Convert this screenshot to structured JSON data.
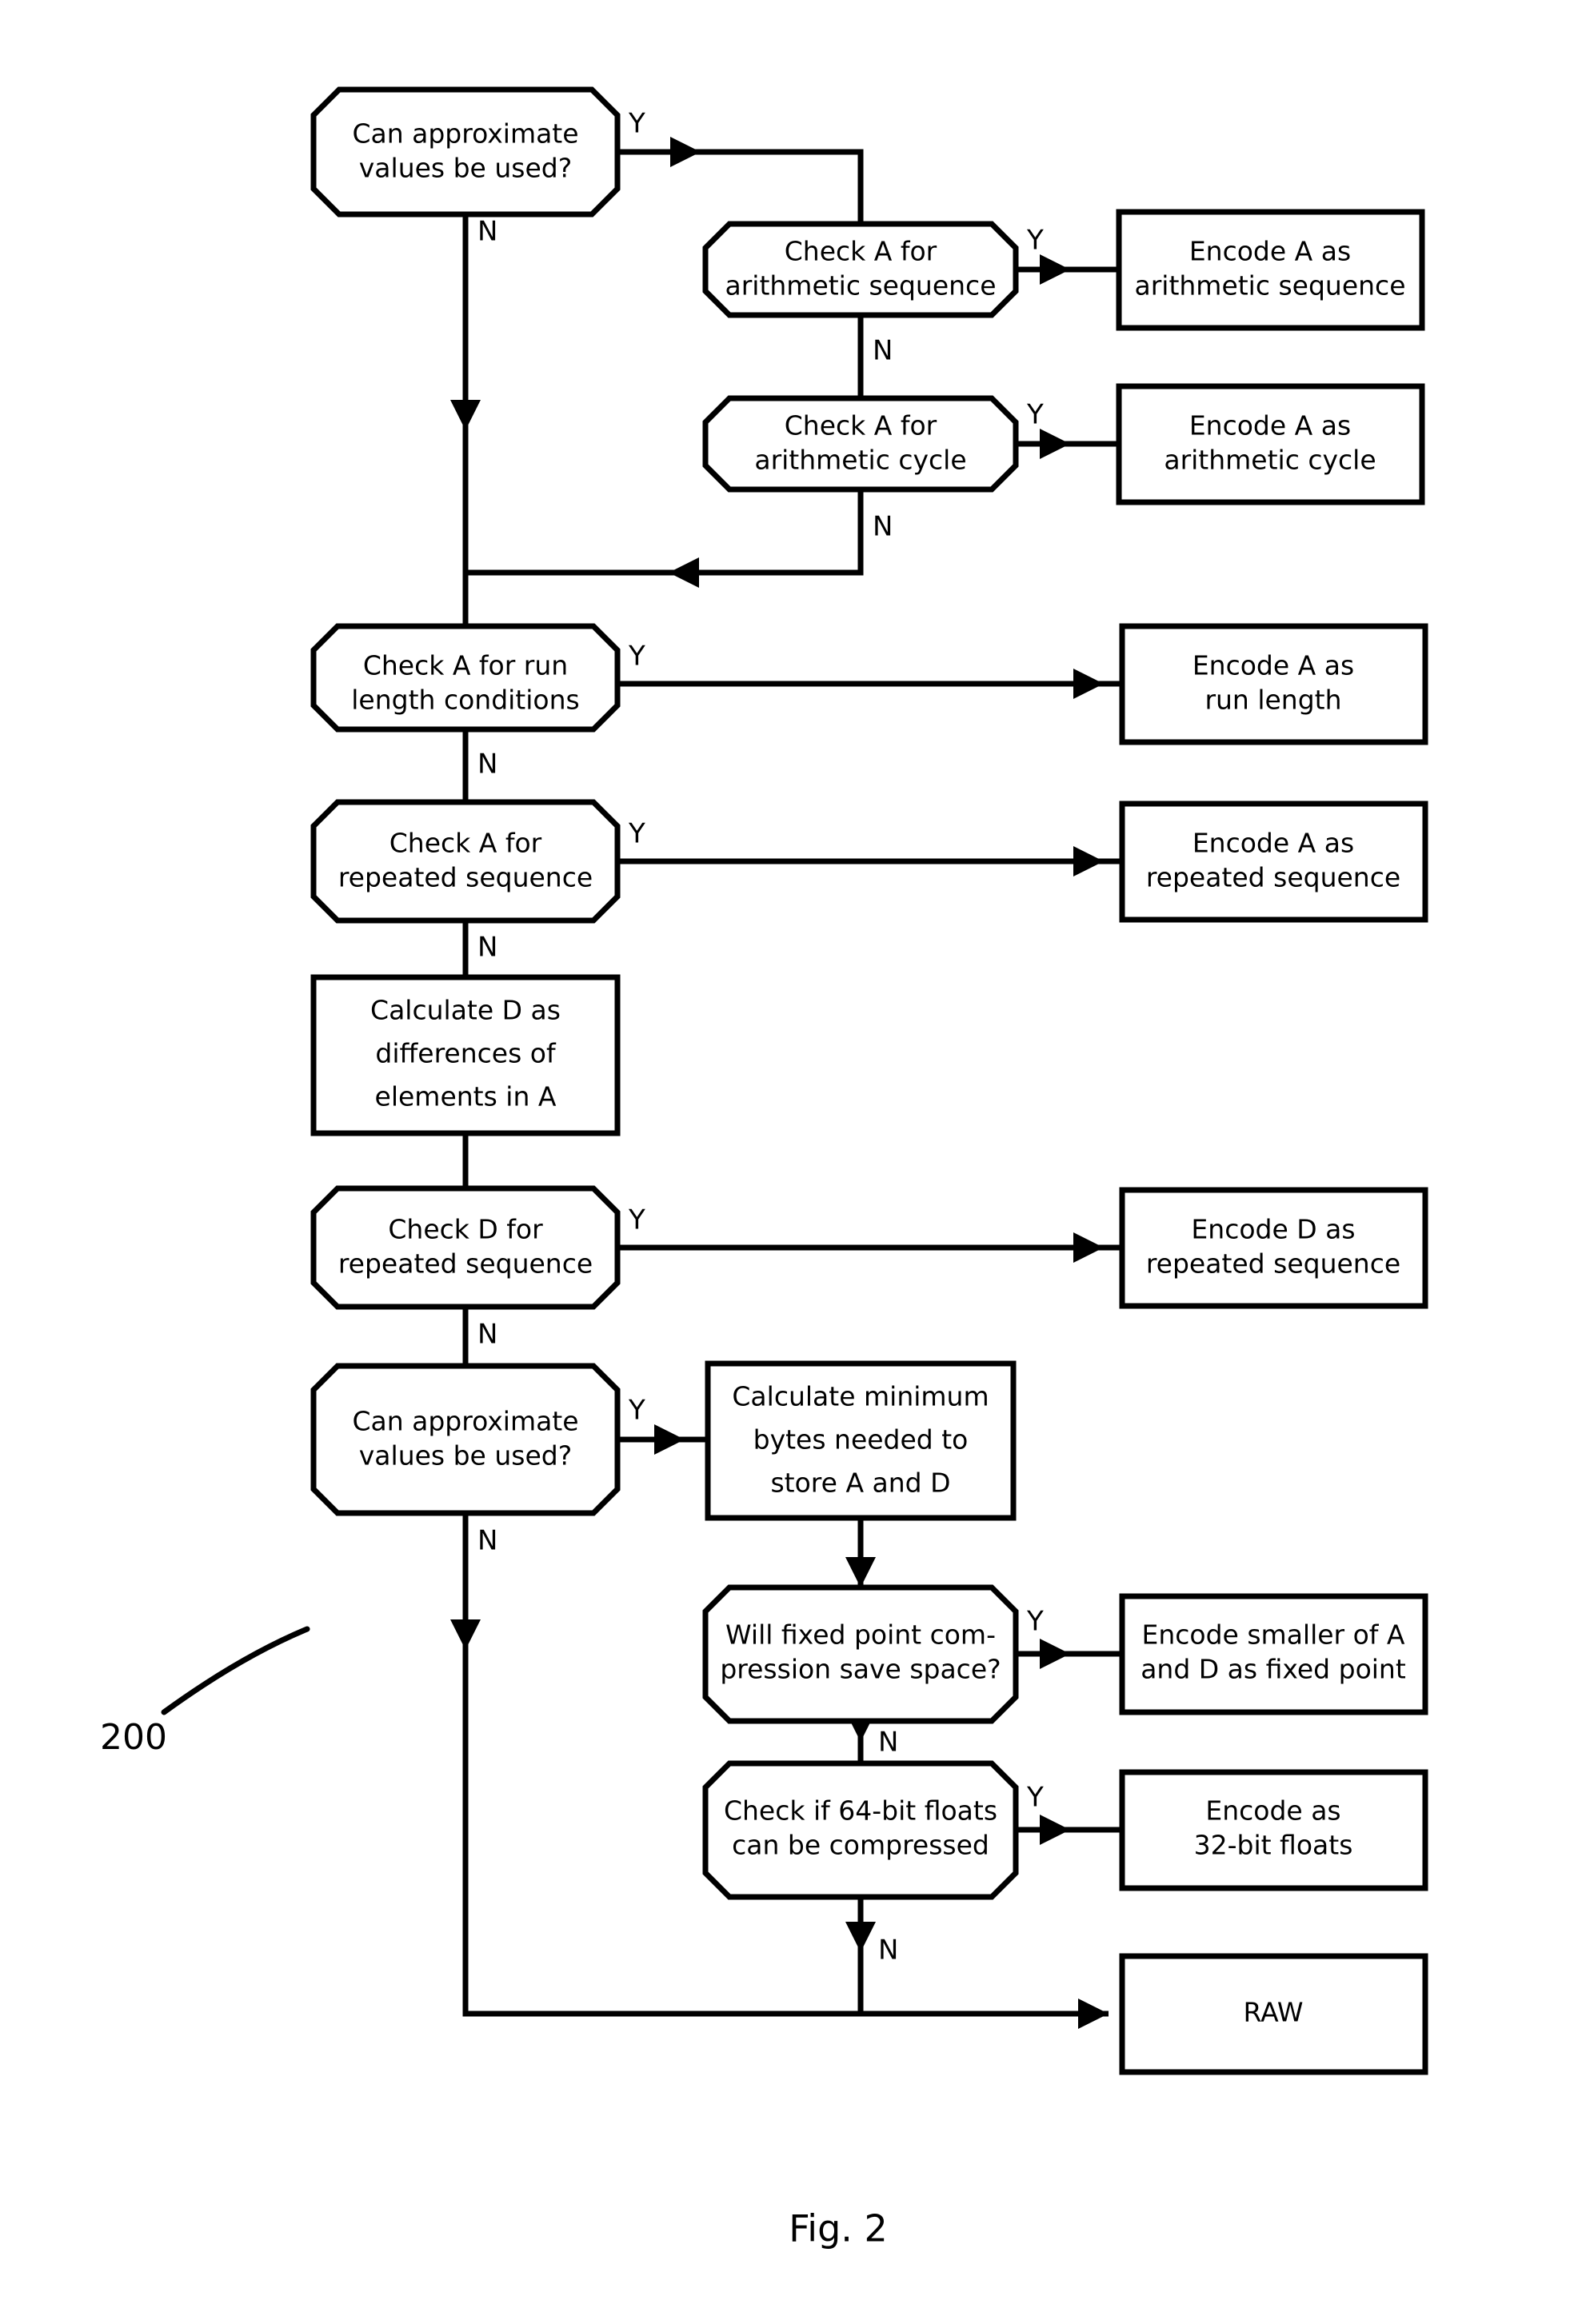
{
  "figure": {
    "caption": "Fig. 2",
    "reference_numeral": "200"
  },
  "branch_labels": {
    "yes": "Y",
    "no": "N"
  },
  "nodes": [
    {
      "id": "can-approx-1",
      "kind": "decision",
      "lines": [
        "Can approximate",
        "values be used?"
      ]
    },
    {
      "id": "check-a-arith-seq",
      "kind": "decision",
      "lines": [
        "Check A for",
        "arithmetic sequence"
      ]
    },
    {
      "id": "encode-a-arith-seq",
      "kind": "process",
      "lines": [
        "Encode A as",
        "arithmetic sequence"
      ]
    },
    {
      "id": "check-a-arith-cycle",
      "kind": "decision",
      "lines": [
        "Check A for",
        "arithmetic cycle"
      ]
    },
    {
      "id": "encode-a-arith-cycle",
      "kind": "process",
      "lines": [
        "Encode A as",
        "arithmetic cycle"
      ]
    },
    {
      "id": "check-a-run-length",
      "kind": "decision",
      "lines": [
        "Check A for run",
        "length conditions"
      ]
    },
    {
      "id": "encode-a-run-length",
      "kind": "process",
      "lines": [
        "Encode A as",
        "run length"
      ]
    },
    {
      "id": "check-a-repeated-seq",
      "kind": "decision",
      "lines": [
        "Check A for",
        "repeated sequence"
      ]
    },
    {
      "id": "encode-a-repeated-seq",
      "kind": "process",
      "lines": [
        "Encode A as",
        "repeated sequence"
      ]
    },
    {
      "id": "calculate-d",
      "kind": "process",
      "lines": [
        "Calculate D as",
        "differences of",
        "elements in A"
      ]
    },
    {
      "id": "check-d-repeated-seq",
      "kind": "decision",
      "lines": [
        "Check D for",
        "repeated sequence"
      ]
    },
    {
      "id": "encode-d-repeated-seq",
      "kind": "process",
      "lines": [
        "Encode D as",
        "repeated sequence"
      ]
    },
    {
      "id": "can-approx-2",
      "kind": "decision",
      "lines": [
        "Can approximate",
        "values be used?"
      ]
    },
    {
      "id": "calculate-min-bytes",
      "kind": "process",
      "lines": [
        "Calculate minimum",
        "bytes needed to",
        "store A and D"
      ]
    },
    {
      "id": "will-fixed-point-save",
      "kind": "decision",
      "lines": [
        "Will fixed point com-",
        "pression save space?"
      ]
    },
    {
      "id": "encode-smaller-fixed-point",
      "kind": "process",
      "lines": [
        "Encode smaller of A",
        "and D as fixed point"
      ]
    },
    {
      "id": "check-64bit-floats",
      "kind": "decision",
      "lines": [
        "Check if 64-bit floats",
        "can be compressed"
      ]
    },
    {
      "id": "encode-32bit-floats",
      "kind": "process",
      "lines": [
        "Encode as",
        "32-bit  floats"
      ]
    },
    {
      "id": "raw",
      "kind": "process",
      "lines": [
        "RAW"
      ]
    }
  ]
}
